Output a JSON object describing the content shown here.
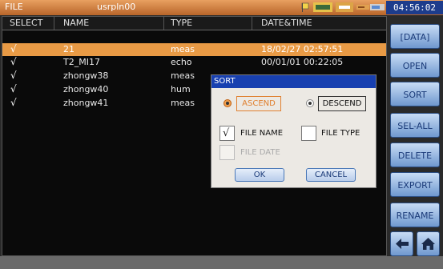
{
  "titlebar": {
    "app": "FILE",
    "path": "usrpln00",
    "clock": "04:56:02",
    "status_icons": [
      "flag-icon",
      "battery-icon",
      "memory-icon",
      "usb-icon",
      "power-icon"
    ]
  },
  "table": {
    "headers": [
      "SELECT",
      "NAME",
      "TYPE",
      "DATE&TIME"
    ],
    "rows": [
      {
        "check": "√",
        "name": "21",
        "type": "meas",
        "date": "18/02/27 02:57:51",
        "selected": true
      },
      {
        "check": "√",
        "name": "T2_MI17",
        "type": "echo",
        "date": "00/01/01 00:22:05",
        "selected": false
      },
      {
        "check": "√",
        "name": "zhongw38",
        "type": "meas",
        "date": "",
        "selected": false
      },
      {
        "check": "√",
        "name": "zhongw40",
        "type": "hum",
        "date": "",
        "selected": false
      },
      {
        "check": "√",
        "name": "zhongw41",
        "type": "meas",
        "date": "",
        "selected": false
      }
    ]
  },
  "sidebar": {
    "buttons": [
      "[DATA]",
      "OPEN",
      "SORT",
      "SEL-ALL",
      "DELETE",
      "EXPORT",
      "RENAME"
    ]
  },
  "nav": {
    "back_icon": "back-arrow-icon",
    "home_icon": "home-icon"
  },
  "dialog": {
    "title": "SORT",
    "ascend": "ASCEND",
    "descend": "DESCEND",
    "file_name": "FILE NAME",
    "file_type": "FILE TYPE",
    "file_date": "FILE DATE",
    "ok": "OK",
    "cancel": "CANCEL",
    "ascend_selected": true,
    "file_name_checked": true,
    "file_type_checked": false,
    "file_date_enabled": false
  },
  "colors": {
    "titlebar": "#c8763a",
    "selected_row": "#e89a45",
    "dialog_title": "#1840b0",
    "button_text": "#1a3a78"
  }
}
